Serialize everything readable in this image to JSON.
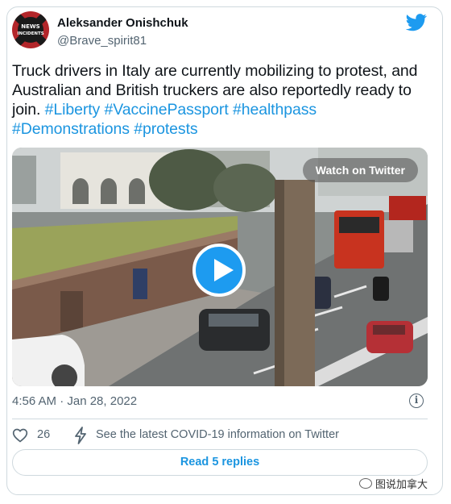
{
  "tweet": {
    "author_name": "Aleksander Onishchuk",
    "handle": "@Brave_spirit81",
    "avatar_text_top": "NEWS",
    "avatar_text_bottom": "INCIDENTS",
    "text_plain": "Truck drivers in Italy are currently mobilizing to protest, and Australian and British truckers are also reportedly ready to join.",
    "hashtags": [
      "#Liberty",
      "#VaccinePassport",
      "#healthpass",
      "#Demonstrations",
      "#protests"
    ],
    "timestamp": "4:56 AM · Jan 28, 2022",
    "likes": "26",
    "covid_link": "See the latest COVID-19 information on Twitter",
    "replies_button": "Read 5 replies"
  },
  "media": {
    "watch_label": "Watch on Twitter",
    "play_icon": "play-icon"
  },
  "colors": {
    "accent": "#1d9bf0",
    "hashtag": "#1b95e0",
    "secondary_text": "#536471",
    "border": "#cfd9de"
  },
  "watermark": {
    "text": "图说加拿大"
  }
}
